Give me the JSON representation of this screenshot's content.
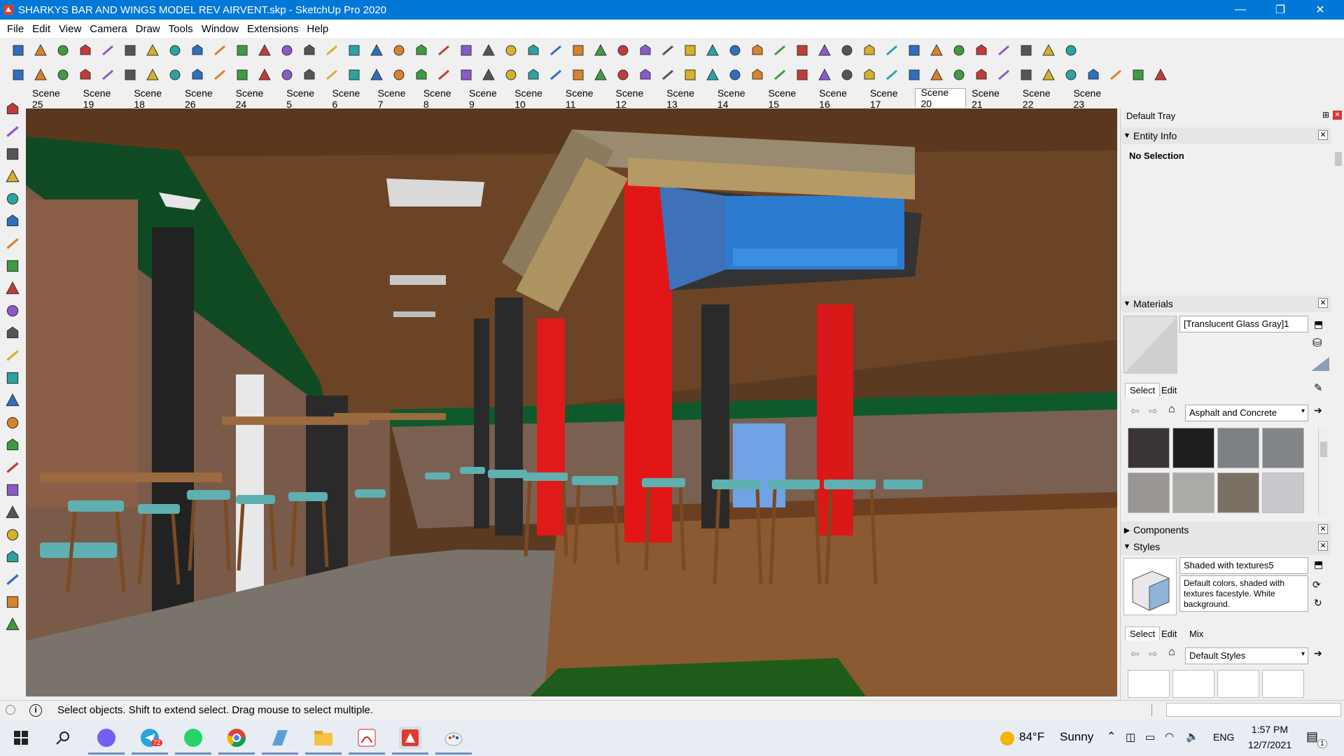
{
  "window": {
    "title": "SHARKYS  BAR AND WINGS MODEL REV AIRVENT.skp - SketchUp Pro 2020",
    "minimize_glyph": "—",
    "maximize_glyph": "❐",
    "close_glyph": "✕"
  },
  "menu": [
    "File",
    "Edit",
    "View",
    "Camera",
    "Draw",
    "Tools",
    "Window",
    "Extensions",
    "Help"
  ],
  "toolbar_row1_icons": [
    "select-icon",
    "eraser-icon",
    "paint-icon",
    "line-icon",
    "rectangle-icon",
    "push-pull-icon",
    "move-icon",
    "rotate-icon",
    "scale-icon",
    "offset-icon",
    "orbit-icon",
    "pan-icon",
    "zoom-icon",
    "zoom-extents-icon",
    "section-icon",
    "walk-icon",
    "look-around-icon",
    "footprints-icon",
    "tape-icon",
    "dimension-icon",
    "protractor-icon",
    "text-icon",
    "axes-icon",
    "3d-text-icon",
    "sandbox-icon",
    "layer-icon",
    "component-icon",
    "scale-balance-icon",
    "warehouse-icon",
    "extension-icon",
    "camera-icon",
    "shadow-icon",
    "fog-icon",
    "x-ray-icon",
    "back-edges-icon",
    "wireframe-icon",
    "hidden-line-icon",
    "shaded-icon",
    "textured-icon",
    "monochrome-icon",
    "arrow-red-icon",
    "arrow-blue-icon",
    "arrow-red2-icon",
    "arrow-green-icon",
    "arrow-orange-icon",
    "arrow-orange2-icon",
    "arrow-pink-icon",
    "curve-icon"
  ],
  "toolbar_row2_icons": [
    "weld-icon",
    "arc-icon",
    "bezier-icon",
    "freehand-icon",
    "follow-me-icon",
    "intersect-icon",
    "union-icon",
    "subtract-icon",
    "trim-icon",
    "split-icon",
    "outer-shell-icon",
    "round-corner-icon",
    "chamfer-icon",
    "fillet-icon",
    "extrude-icon",
    "loft-icon",
    "sweep-icon",
    "skin-icon",
    "shape-bender-icon",
    "flowify-icon",
    "grid-icon",
    "array-icon",
    "mirror-icon",
    "align-icon",
    "distribute-icon",
    "stair-icon",
    "railing-icon",
    "window-tool-icon",
    "door-tool-icon",
    "wall-tool-icon",
    "roof-icon",
    "beam-icon",
    "column-icon",
    "slab-icon",
    "truss-icon",
    "joist-icon",
    "stud-icon",
    "rafter-icon",
    "panel-icon",
    "glass-icon",
    "frame-icon",
    "profile-icon",
    "scale-tool-icon",
    "plugin-a-icon",
    "plugin-b-icon",
    "plugin-c-icon",
    "plugin-d-icon",
    "plugin-e-icon",
    "plugin-f-icon",
    "plugin-g-icon",
    "plugin-h-icon",
    "plugin-i-icon"
  ],
  "scene_tabs": [
    "Scene 25",
    "Scene 19",
    "Scene 18",
    "Scene 26",
    "Scene 24",
    "Scene 5",
    "Scene 6",
    "Scene 7",
    "Scene 8",
    "Scene 9",
    "Scene 10",
    "Scene 11",
    "Scene 12",
    "Scene 13",
    "Scene 14",
    "Scene 15",
    "Scene 16",
    "Scene 17",
    "Scene 20",
    "Scene 21",
    "Scene 22",
    "Scene 23"
  ],
  "active_scene": "Scene 20",
  "tray": {
    "title": "Default Tray",
    "entity_info": {
      "title": "Entity Info",
      "selection": "No Selection"
    },
    "materials": {
      "title": "Materials",
      "name": "[Translucent Glass Gray]1",
      "tab_select": "Select",
      "tab_edit": "Edit",
      "library": "Asphalt and Concrete",
      "swatches": [
        "#3a3436",
        "#1e1e1e",
        "#7d8083",
        "#838688",
        "#9a9694",
        "#a9aca6",
        "#7b7064",
        "#c9c8cc"
      ]
    },
    "components": {
      "title": "Components"
    },
    "styles": {
      "title": "Styles",
      "name": "Shaded with textures5",
      "description": "Default colors, shaded with textures facestyle. White background.",
      "tab_select": "Select",
      "tab_edit": "Edit",
      "tab_mix": "Mix",
      "library": "Default Styles"
    }
  },
  "status": {
    "message": "Select objects. Shift to extend select. Drag mouse to select multiple."
  },
  "taskbar": {
    "apps": [
      "start-icon",
      "search-icon",
      "viber-icon",
      "telegram-icon",
      "whatsapp-icon",
      "chrome-icon",
      "photos-icon",
      "file-explorer-icon",
      "acrobat-icon",
      "sketchup-icon",
      "paint-icon"
    ],
    "telegram_badge": "72",
    "weather_temp": "84°F",
    "weather_text": "Sunny",
    "language": "ENG",
    "time": "1:57 PM",
    "date": "12/7/2021",
    "notifications": "1"
  },
  "colors": {
    "titlebar": "#0078d7",
    "ceiling": "#6b4426",
    "brick": "#7a5a48",
    "column_red": "#e01a1a",
    "stool_seat": "#5fb0b0",
    "wood": "#9b6a3e"
  }
}
